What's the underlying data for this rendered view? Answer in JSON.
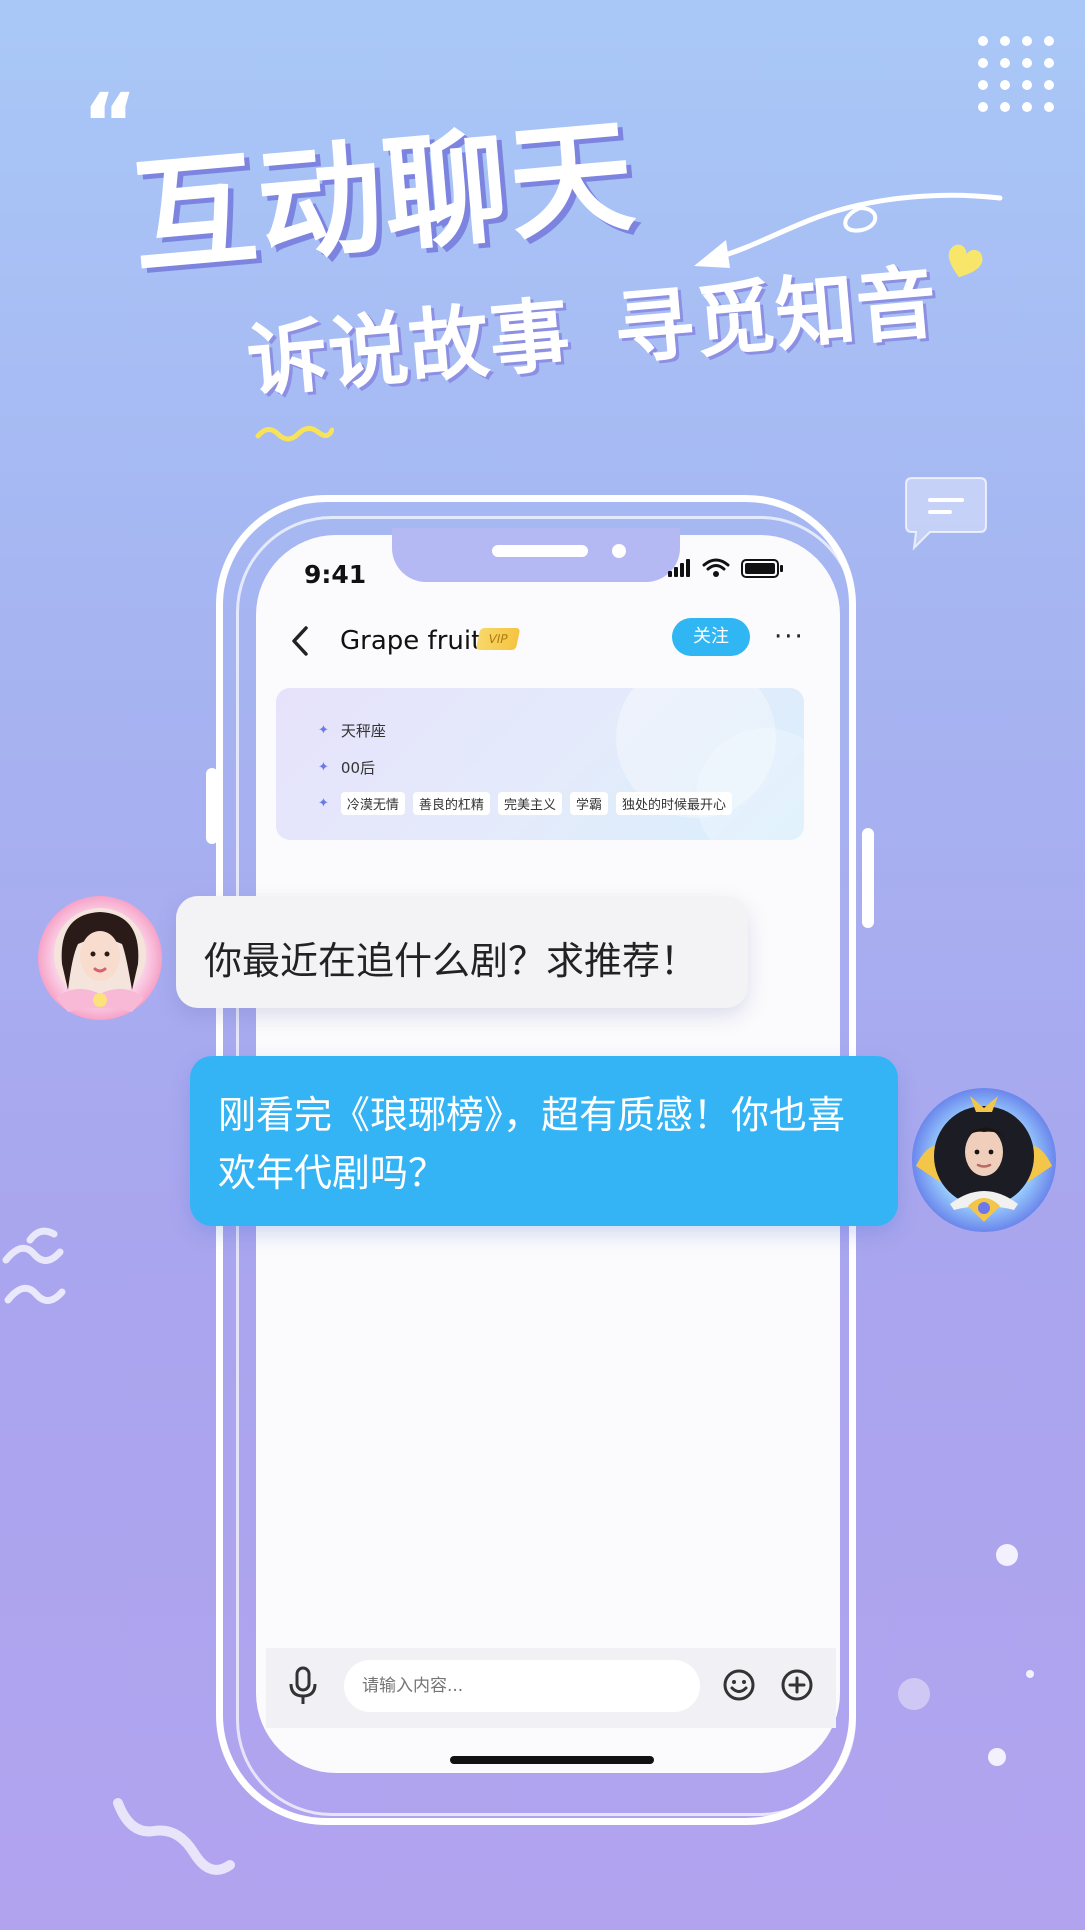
{
  "promo": {
    "headline": "互动聊天",
    "subline_left": "诉说故事",
    "subline_right": "寻觅知音",
    "quote_mark": "“"
  },
  "phone": {
    "status_bar": {
      "time": "9:41",
      "icons": [
        "signal-icon",
        "wifi-icon",
        "battery-icon"
      ]
    },
    "header": {
      "back_icon": "chevron-left-icon",
      "name": "Grape fruit",
      "vip_badge": "VIP",
      "follow_label": "关注",
      "more_label": "···"
    },
    "profile": {
      "zodiac": "天秤座",
      "generation": "00后",
      "tags": [
        "冷漠无情",
        "善良的杠精",
        "完美主义",
        "学霸",
        "独处的时候最开心"
      ]
    },
    "input_bar": {
      "placeholder": "请输入内容...",
      "icons": [
        "mic-icon",
        "emoji-icon",
        "plus-icon"
      ]
    }
  },
  "messages": [
    {
      "side": "left",
      "text": "你最近在追什么剧？求推荐！"
    },
    {
      "side": "right",
      "text": "刚看完《琅琊榜》，超有质感！你也喜欢年代剧吗？"
    }
  ],
  "colors": {
    "accent_blue": "#34b4f5",
    "follow_blue": "#2fb6f3",
    "vip_gold": "#f5c441",
    "background_top": "#a9c8f7",
    "background_bottom": "#b2a3ef"
  }
}
